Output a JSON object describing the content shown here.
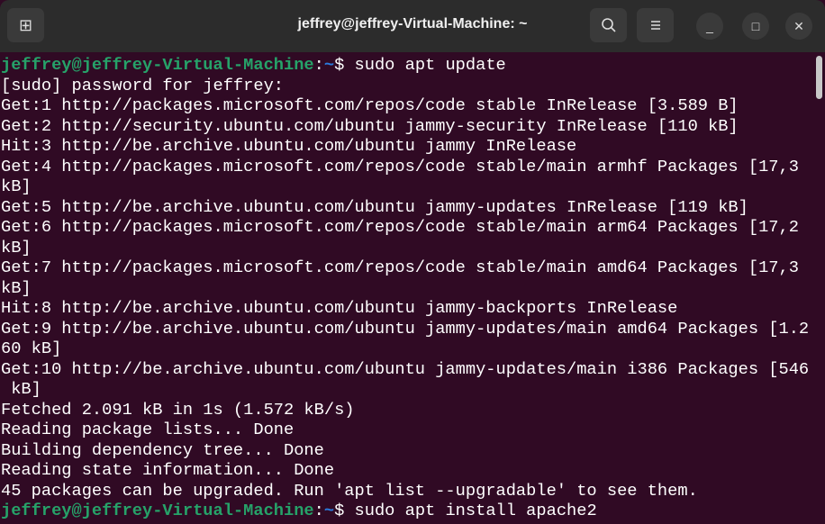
{
  "window": {
    "title": "jeffrey@jeffrey-Virtual-Machine: ~"
  },
  "toolbar": {
    "new_tab_icon": "new-tab-icon",
    "search_icon": "search-icon",
    "menu_icon": "hamburger-icon",
    "minimize": "_",
    "maximize": "□",
    "close": "✕"
  },
  "terminal": {
    "prompt_user": "jeffrey@jeffrey-Virtual-Machine",
    "prompt_sep": ":",
    "prompt_path": "~",
    "prompt_dollar": "$ ",
    "command1": "sudo apt update",
    "output": [
      "[sudo] password for jeffrey:",
      "Get:1 http://packages.microsoft.com/repos/code stable InRelease [3.589 B]",
      "Get:2 http://security.ubuntu.com/ubuntu jammy-security InRelease [110 kB]",
      "Hit:3 http://be.archive.ubuntu.com/ubuntu jammy InRelease",
      "Get:4 http://packages.microsoft.com/repos/code stable/main armhf Packages [17,3",
      "kB]",
      "Get:5 http://be.archive.ubuntu.com/ubuntu jammy-updates InRelease [119 kB]",
      "Get:6 http://packages.microsoft.com/repos/code stable/main arm64 Packages [17,2",
      "kB]",
      "Get:7 http://packages.microsoft.com/repos/code stable/main amd64 Packages [17,3",
      "kB]",
      "Hit:8 http://be.archive.ubuntu.com/ubuntu jammy-backports InRelease",
      "Get:9 http://be.archive.ubuntu.com/ubuntu jammy-updates/main amd64 Packages [1.2",
      "60 kB]",
      "Get:10 http://be.archive.ubuntu.com/ubuntu jammy-updates/main i386 Packages [546",
      " kB]",
      "Fetched 2.091 kB in 1s (1.572 kB/s)",
      "Reading package lists... Done",
      "Building dependency tree... Done",
      "Reading state information... Done",
      "45 packages can be upgraded. Run 'apt list --upgradable' to see them."
    ],
    "command2": "sudo apt install apache2"
  },
  "colors": {
    "background": "#300a24",
    "prompt_user": "#26a269",
    "prompt_path": "#2a7bde"
  }
}
